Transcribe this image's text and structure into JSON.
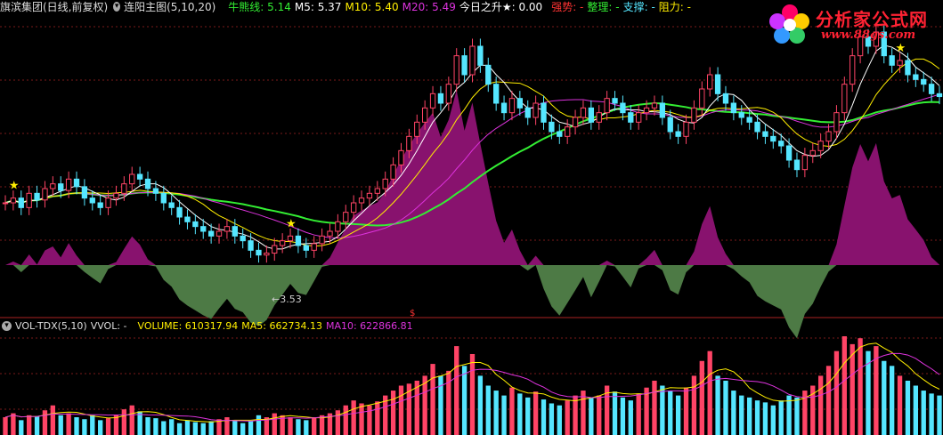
{
  "header": {
    "stock_name": "旗滨集团(日线,前复权)",
    "indicator_name": "连阳主图(5,10,20)",
    "bear_label": "牛熊线: 5.14",
    "m5_label": "M5: 5.37",
    "m10_label": "M10: 5.40",
    "m20_label": "M20: 5.49",
    "today_label": "今日之升★: 0.00",
    "strong_label": "强势: -",
    "consolidate_label": "整理: -",
    "support_label": "支撑: -",
    "resist_label": "阻力: -"
  },
  "volume_header": {
    "name": "VOL-TDX(5,10)",
    "vvol_label": "VVOL: -",
    "volume_label": "VOLUME: 610317.94",
    "ma5_label": "MA5: 662734.13",
    "ma10_label": "MA10: 622866.81"
  },
  "logo": {
    "title": "分析家公式网",
    "url": "www.88gs.com"
  },
  "annotations": {
    "low_price_label": "←3.53",
    "separator_mark": "$"
  },
  "colors": {
    "up": "#ff4466",
    "down": "#55e6ff",
    "ma_white": "#ffffff",
    "ma_yellow": "#ffee00",
    "ma_magenta": "#dd33dd",
    "bear_line": "#33ee33",
    "osc_pos": "#88126e",
    "osc_neg": "#4d7a45",
    "grid": "#7a1a1a"
  },
  "chart_data": [
    {
      "type": "candlestick",
      "title": "连阳主图(5,10,20)",
      "ylim": [
        3.2,
        6.2
      ],
      "annotated_low": 3.53,
      "series": [
        {
          "name": "M5",
          "last": 5.37
        },
        {
          "name": "M10",
          "last": 5.4
        },
        {
          "name": "M20",
          "last": 5.49
        },
        {
          "name": "牛熊线",
          "last": 5.14
        }
      ],
      "close": [
        4.25,
        4.3,
        4.2,
        4.35,
        4.28,
        4.4,
        4.45,
        4.38,
        4.5,
        4.42,
        4.3,
        4.25,
        4.2,
        4.3,
        4.35,
        4.45,
        4.55,
        4.5,
        4.4,
        4.35,
        4.25,
        4.2,
        4.1,
        4.05,
        4.0,
        3.95,
        3.9,
        3.95,
        4.0,
        3.9,
        3.85,
        3.75,
        3.7,
        3.72,
        3.8,
        3.85,
        3.9,
        3.8,
        3.75,
        3.82,
        3.9,
        3.95,
        4.05,
        4.15,
        4.25,
        4.3,
        4.35,
        4.4,
        4.5,
        4.65,
        4.8,
        4.95,
        5.1,
        5.25,
        5.4,
        5.3,
        5.5,
        5.8,
        5.6,
        5.9,
        5.7,
        5.5,
        5.3,
        5.2,
        5.35,
        5.25,
        5.15,
        5.3,
        5.1,
        5.0,
        4.95,
        5.05,
        5.15,
        5.25,
        5.1,
        5.2,
        5.35,
        5.3,
        5.2,
        5.1,
        5.2,
        5.25,
        5.3,
        5.15,
        5.0,
        4.95,
        5.1,
        5.25,
        5.45,
        5.6,
        5.4,
        5.3,
        5.2,
        5.15,
        5.1,
        5.0,
        4.95,
        4.9,
        4.85,
        4.7,
        4.6,
        4.75,
        4.8,
        4.9,
        5.0,
        5.2,
        5.5,
        5.8,
        6.0,
        5.9,
        6.05,
        5.8,
        5.7,
        5.75,
        5.6,
        5.55,
        5.5,
        5.4,
        5.37
      ]
    },
    {
      "type": "bar",
      "title": "VOL-TDX(5,10)",
      "series": [
        {
          "name": "VOLUME",
          "last": 610317.94
        },
        {
          "name": "MA5",
          "last": 662734.13
        },
        {
          "name": "MA10",
          "last": 622866.81
        }
      ],
      "values": [
        0.18,
        0.22,
        0.15,
        0.2,
        0.19,
        0.25,
        0.3,
        0.2,
        0.22,
        0.18,
        0.16,
        0.2,
        0.15,
        0.17,
        0.2,
        0.26,
        0.3,
        0.24,
        0.18,
        0.17,
        0.14,
        0.16,
        0.12,
        0.15,
        0.13,
        0.12,
        0.14,
        0.16,
        0.18,
        0.15,
        0.12,
        0.14,
        0.2,
        0.18,
        0.22,
        0.2,
        0.18,
        0.16,
        0.15,
        0.18,
        0.2,
        0.22,
        0.25,
        0.3,
        0.35,
        0.32,
        0.3,
        0.34,
        0.4,
        0.45,
        0.5,
        0.52,
        0.55,
        0.6,
        0.72,
        0.6,
        0.65,
        0.9,
        0.7,
        0.82,
        0.6,
        0.5,
        0.45,
        0.4,
        0.48,
        0.42,
        0.38,
        0.44,
        0.36,
        0.32,
        0.3,
        0.35,
        0.4,
        0.45,
        0.38,
        0.4,
        0.5,
        0.44,
        0.38,
        0.35,
        0.42,
        0.48,
        0.55,
        0.5,
        0.45,
        0.4,
        0.48,
        0.6,
        0.75,
        0.85,
        0.6,
        0.55,
        0.45,
        0.4,
        0.38,
        0.35,
        0.33,
        0.3,
        0.35,
        0.4,
        0.38,
        0.45,
        0.5,
        0.6,
        0.7,
        0.85,
        1.0,
        0.92,
        0.98,
        0.85,
        0.9,
        0.75,
        0.7,
        0.6,
        0.55,
        0.5,
        0.45,
        0.42,
        0.4
      ]
    }
  ]
}
